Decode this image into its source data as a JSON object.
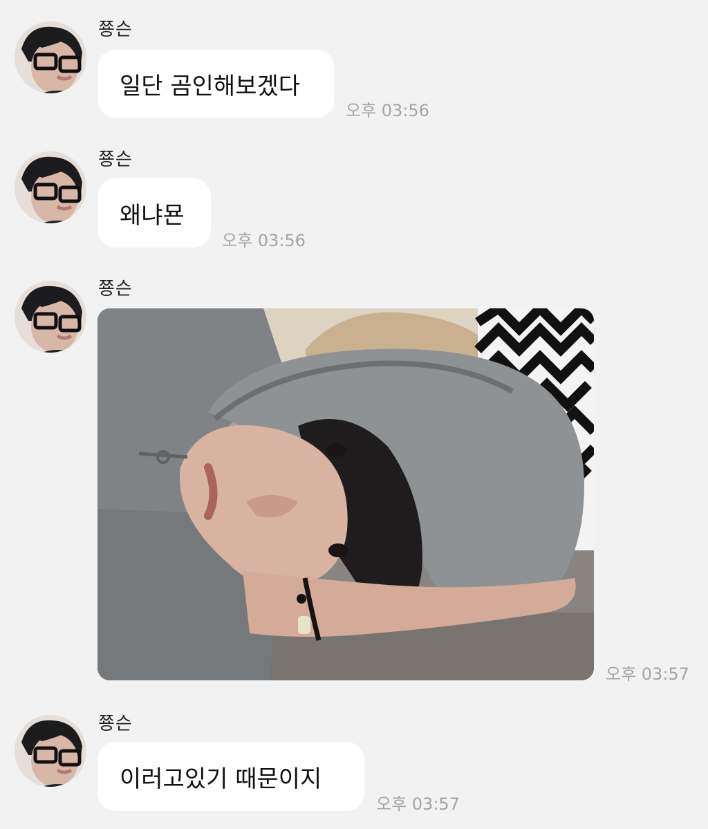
{
  "messages": [
    {
      "sender": "쭁슨",
      "type": "text",
      "text": "일단 곰인해보겠다",
      "time": "오후 03:56"
    },
    {
      "sender": "쭁슨",
      "type": "text",
      "text": "왜냐묜",
      "time": "오후 03:56"
    },
    {
      "sender": "쭁슨",
      "type": "image",
      "image": "selfie-photo-gray-hoodie",
      "time": "오후 03:57"
    },
    {
      "sender": "쭁슨",
      "type": "text",
      "text": "이러고있기 때문이지",
      "time": "오후 03:57"
    }
  ],
  "colors": {
    "background": "#f2f2f2",
    "bubble": "#ffffff",
    "time_text": "#a4a4a4"
  }
}
